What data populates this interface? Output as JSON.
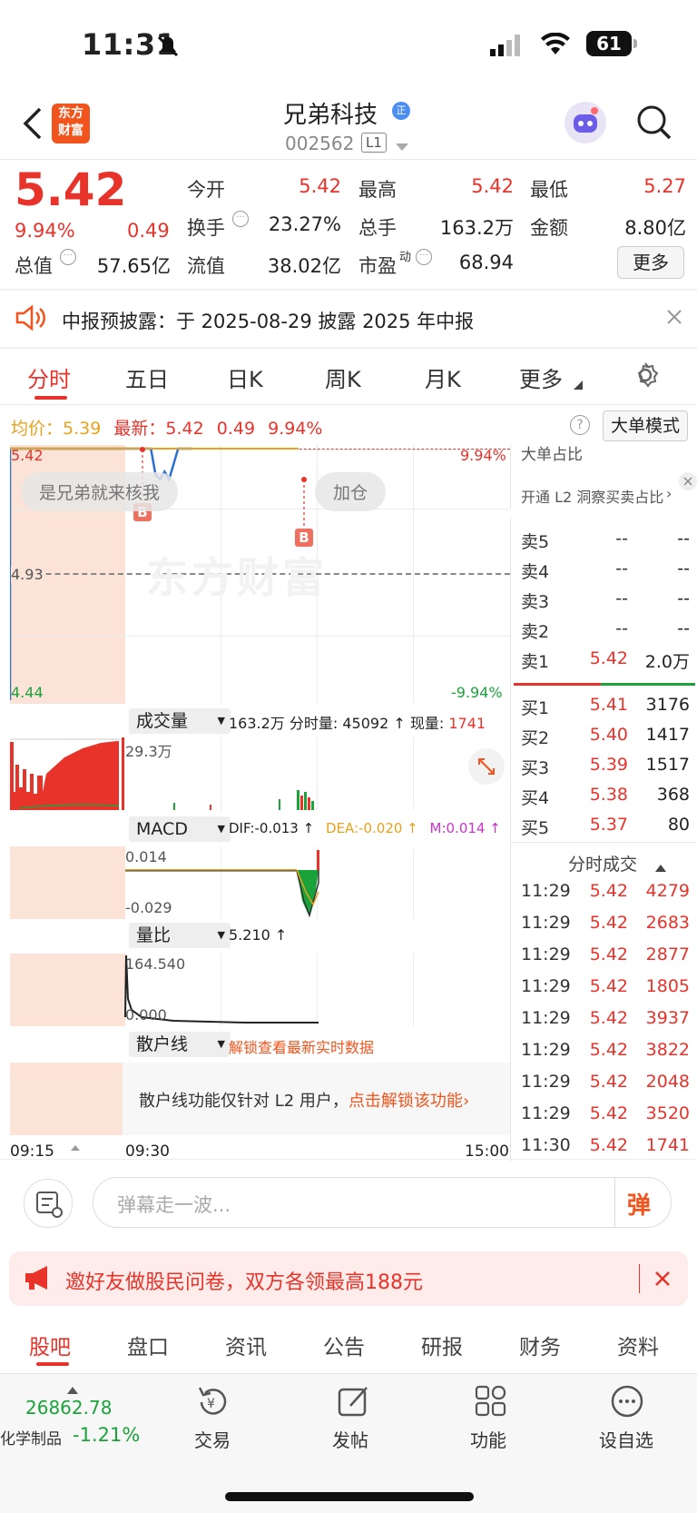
{
  "status_bar": {
    "time": "11:31",
    "battery": "61"
  },
  "header": {
    "stock_name": "兄弟科技",
    "badge": "正",
    "code": "002562",
    "level": "L1",
    "logo_line1": "东方",
    "logo_line2": "财富"
  },
  "quote": {
    "price": "5.42",
    "change_pct": "9.94%",
    "change": "0.49",
    "open_label": "今开",
    "open": "5.42",
    "high_label": "最高",
    "high": "5.42",
    "low_label": "最低",
    "low": "5.27",
    "turnover_label": "换手",
    "turnover": "23.27%",
    "volume_label": "总手",
    "volume": "163.2万",
    "amount_label": "金额",
    "amount": "8.80亿",
    "mktcap_label": "总值",
    "mktcap": "57.65亿",
    "float_label": "流值",
    "float": "38.02亿",
    "pe_label": "市盈",
    "pe_sup": "动",
    "pe": "68.94",
    "more_button": "更多"
  },
  "notice": {
    "text": "中报预披露：于 2025-08-29 披露 2025 年中报"
  },
  "tabs": [
    "分时",
    "五日",
    "日K",
    "周K",
    "月K",
    "更多"
  ],
  "chart_header": {
    "avg_label": "均价：",
    "avg": "5.39",
    "latest_label": "最新：",
    "latest": "5.42",
    "chg": "0.49",
    "pct": "9.94%",
    "bigorder_btn": "大单模式"
  },
  "chart_data": {
    "type": "line",
    "title": "",
    "price_axis": {
      "top": "5.42",
      "mid": "4.93",
      "bottom": "4.44",
      "top_pct": "9.94%",
      "bottom_pct": "-9.94%"
    },
    "time_axis": [
      "09:15",
      "09:30",
      "15:00"
    ],
    "price_ylim": [
      4.44,
      5.42
    ],
    "series": [
      {
        "x": [
          0,
          0.3,
          0.31,
          0.32,
          0.33,
          0.34,
          0.35,
          0.36,
          0.37,
          0.4
        ],
        "y": [
          5.42,
          5.42,
          5.42,
          5.32,
          5.3,
          5.33,
          5.3,
          5.36,
          5.42,
          5.42
        ]
      }
    ]
  },
  "chip_left": "是兄弟就来核我",
  "chip_right": "加仓",
  "watermark": "东方财富",
  "marker_b": "B",
  "volume_panel": {
    "label": "成交量",
    "summary": "163.2万 分时量: 45092 ↑ 现量: ",
    "current": "1741",
    "axis_top": "29.3万"
  },
  "macd_panel": {
    "label": "MACD",
    "dif": "DIF:-0.013 ↑",
    "dea": "DEA:-0.020 ↑",
    "m": "M:0.014 ↑",
    "axis_top": "0.014",
    "axis_bottom": "-0.029"
  },
  "ratio_panel": {
    "label": "量比",
    "value": "5.210 ↑",
    "axis_top": "164.540",
    "axis_bottom": "0.000"
  },
  "retail_panel": {
    "label": "散户线",
    "unlock": "解锁查看最新实时数据",
    "msg": "散户线功能仅针对 L2 用户，",
    "cta": "点击解锁该功能"
  },
  "side_panel": {
    "top_partial": "大单占比",
    "l2_promo": "开通 L2 洞察买卖占比",
    "sell": [
      {
        "label": "卖5",
        "price": "--",
        "vol": "--"
      },
      {
        "label": "卖4",
        "price": "--",
        "vol": "--"
      },
      {
        "label": "卖3",
        "price": "--",
        "vol": "--"
      },
      {
        "label": "卖2",
        "price": "--",
        "vol": "--"
      },
      {
        "label": "卖1",
        "price": "5.42",
        "vol": "2.0万"
      }
    ],
    "buy": [
      {
        "label": "买1",
        "price": "5.41",
        "vol": "3176"
      },
      {
        "label": "买2",
        "price": "5.40",
        "vol": "1417"
      },
      {
        "label": "买3",
        "price": "5.39",
        "vol": "1517"
      },
      {
        "label": "买4",
        "price": "5.38",
        "vol": "368"
      },
      {
        "label": "买5",
        "price": "5.37",
        "vol": "80"
      }
    ],
    "ticks_title": "分时成交",
    "ticks": [
      {
        "t": "11:29",
        "p": "5.42",
        "v": "4279"
      },
      {
        "t": "11:29",
        "p": "5.42",
        "v": "2683"
      },
      {
        "t": "11:29",
        "p": "5.42",
        "v": "2877"
      },
      {
        "t": "11:29",
        "p": "5.42",
        "v": "1805"
      },
      {
        "t": "11:29",
        "p": "5.42",
        "v": "3937"
      },
      {
        "t": "11:29",
        "p": "5.42",
        "v": "3822"
      },
      {
        "t": "11:29",
        "p": "5.42",
        "v": "2048"
      },
      {
        "t": "11:29",
        "p": "5.42",
        "v": "3520"
      },
      {
        "t": "11:30",
        "p": "5.42",
        "v": "1741"
      }
    ]
  },
  "danmaku": {
    "placeholder": "弹幕走一波...",
    "btn": "弹"
  },
  "promo": {
    "text": "邀好友做股民问卷，双方各领最高188元"
  },
  "bottom_tabs": [
    "股吧",
    "盘口",
    "资讯",
    "公告",
    "研报",
    "财务",
    "资料"
  ],
  "toolbar": {
    "index_value": "26862.78",
    "index_name": "化学制品",
    "index_change": "-1.21%",
    "trade": "交易",
    "post": "发帖",
    "func": "功能",
    "watch": "设自选"
  }
}
